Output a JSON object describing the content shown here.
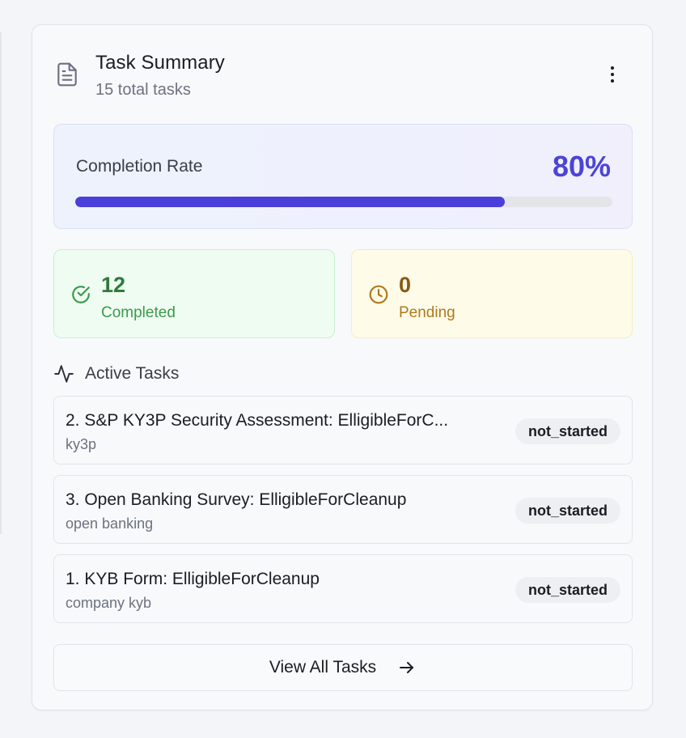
{
  "header": {
    "title": "Task Summary",
    "subtitle": "15 total tasks",
    "icon": "file-text-icon",
    "menu_icon": "more-vertical-icon"
  },
  "completion": {
    "label": "Completion Rate",
    "value_text": "80%",
    "percent": 80,
    "accent_color": "#4a3fd8"
  },
  "stats": {
    "completed": {
      "value": "12",
      "label": "Completed",
      "icon": "check-circle-icon",
      "color": "#2f7a3a"
    },
    "pending": {
      "value": "0",
      "label": "Pending",
      "icon": "clock-icon",
      "color": "#8a5a12"
    }
  },
  "active_tasks": {
    "title": "Active Tasks",
    "icon": "activity-icon",
    "items": [
      {
        "name": "2. S&P KY3P Security Assessment: ElligibleForC...",
        "type": "ky3p",
        "status": "not_started"
      },
      {
        "name": "3. Open Banking Survey: ElligibleForCleanup",
        "type": "open banking",
        "status": "not_started"
      },
      {
        "name": "1. KYB Form: ElligibleForCleanup",
        "type": "company kyb",
        "status": "not_started"
      }
    ]
  },
  "footer": {
    "view_all_label": "View All Tasks",
    "icon": "arrow-right-icon"
  }
}
